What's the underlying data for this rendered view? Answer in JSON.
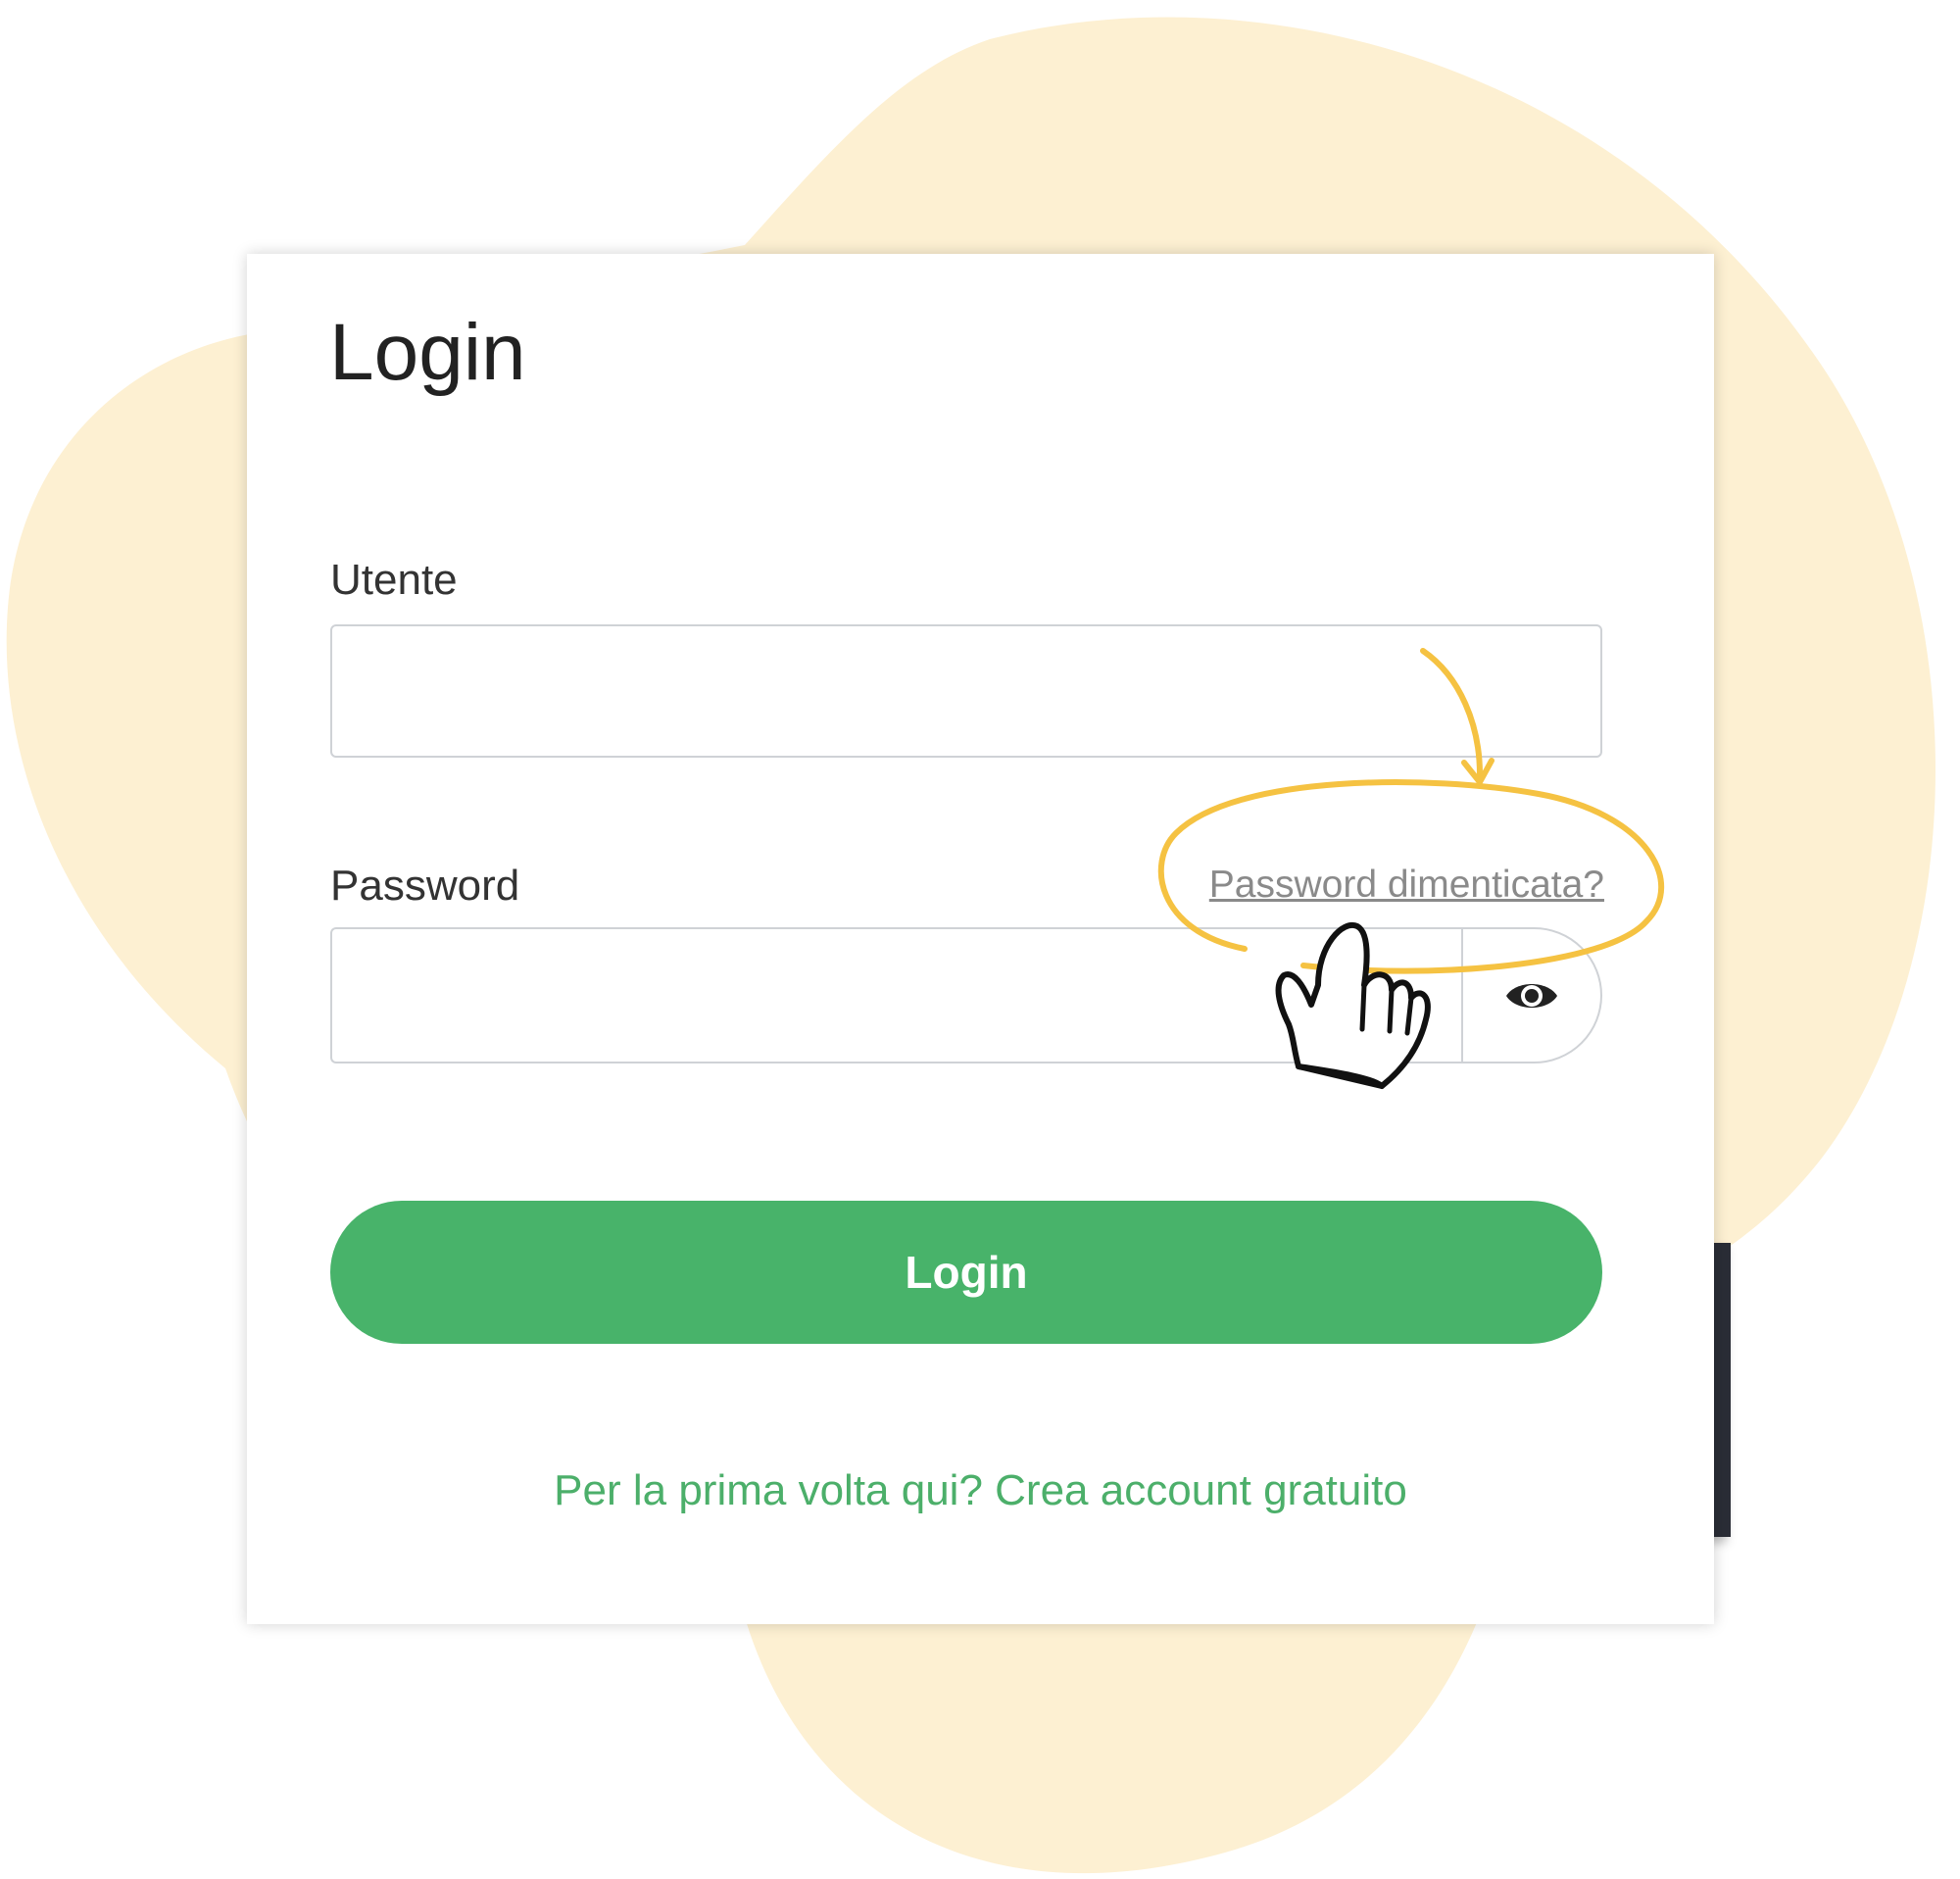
{
  "login_card": {
    "title": "Login",
    "username_label": "Utente",
    "username_value": "",
    "password_label": "Password",
    "password_value": "",
    "forgot_password_link": "Password dimenticata?",
    "toggle_visibility_icon": "eye-icon",
    "login_button_label": "Login",
    "signup_prompt": "Per la prima volta qui?",
    "signup_link": "Crea account gratuito"
  },
  "annotations": {
    "highlight_color": "#f5c242",
    "pointer_icon": "hand-pointer-icon",
    "arrow_icon": "curved-arrow-icon"
  },
  "colors": {
    "background_blob": "#fdf0d2",
    "login_button": "#48b36a",
    "signup_text": "#4caf6a"
  }
}
